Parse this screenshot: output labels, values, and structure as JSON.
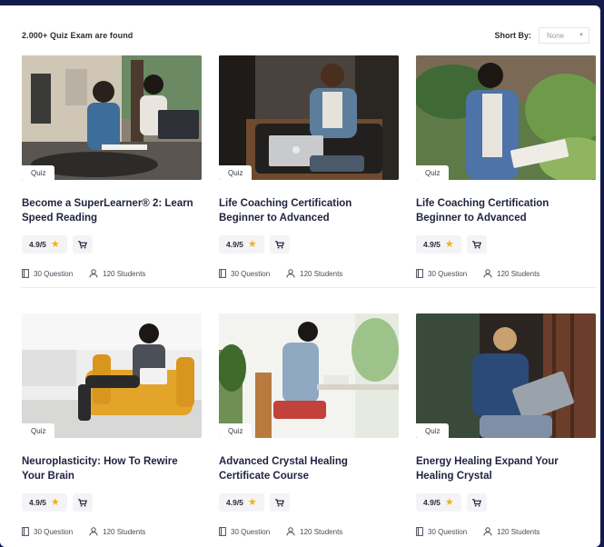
{
  "header": {
    "found_text": "2.000+ Quiz Exam are found",
    "sort_label": "Short By:",
    "sort_value": "None"
  },
  "cards": [
    {
      "tag": "Quiz",
      "title": "Become a SuperLearner® 2: Learn Speed Reading",
      "rating": "4.9/5",
      "questions": "30 Question",
      "students": "120 Students"
    },
    {
      "tag": "Quiz",
      "title": "Life Coaching Certification Beginner to Advanced",
      "rating": "4.9/5",
      "questions": "30 Question",
      "students": "120 Students"
    },
    {
      "tag": "Quiz",
      "title": "Life Coaching Certification Beginner to Advanced",
      "rating": "4.9/5",
      "questions": "30 Question",
      "students": "120 Students"
    },
    {
      "tag": "Quiz",
      "title": "Neuroplasticity: How To Rewire Your Brain",
      "rating": "4.9/5",
      "questions": "30 Question",
      "students": "120 Students"
    },
    {
      "tag": "Quiz",
      "title": "Advanced Crystal Healing Certificate Course",
      "rating": "4.9/5",
      "questions": "30 Question",
      "students": "120 Students"
    },
    {
      "tag": "Quiz",
      "title": "Energy Healing Expand Your Healing Crystal",
      "rating": "4.9/5",
      "questions": "30 Question",
      "students": "120 Students"
    }
  ],
  "colors": {
    "page_background": "#141a4a",
    "panel": "#ffffff",
    "star": "#f4b400",
    "title_text": "#1f2340"
  },
  "icons": [
    "chevron-down-icon",
    "star-icon",
    "cart-icon",
    "question-book-icon",
    "student-user-icon"
  ]
}
